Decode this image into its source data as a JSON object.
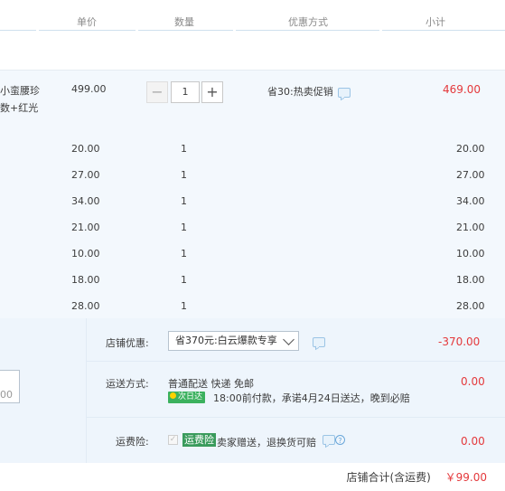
{
  "header": {
    "unit_price": "单价",
    "quantity": "数量",
    "discount_method": "优惠方式",
    "subtotal": "小计"
  },
  "main_item": {
    "name_line1": "小蛮腰珍",
    "name_line2": "数+红光",
    "price": "499.00",
    "quantity": "1",
    "minus": "−",
    "plus": "+",
    "promo": "省30:热卖促销",
    "subtotal": "469.00"
  },
  "items": [
    {
      "price": "20.00",
      "qty": "1",
      "subtotal": "20.00"
    },
    {
      "price": "27.00",
      "qty": "1",
      "subtotal": "27.00"
    },
    {
      "price": "34.00",
      "qty": "1",
      "subtotal": "34.00"
    },
    {
      "price": "21.00",
      "qty": "1",
      "subtotal": "21.00"
    },
    {
      "price": "10.00",
      "qty": "1",
      "subtotal": "10.00"
    },
    {
      "price": "18.00",
      "qty": "1",
      "subtotal": "18.00"
    },
    {
      "price": "28.00",
      "qty": "1",
      "subtotal": "28.00"
    }
  ],
  "shop_discount": {
    "label": "店铺优惠:",
    "selected": "省370元:白云爆款专享",
    "amount": "-370.00"
  },
  "shipping": {
    "label": "运送方式:",
    "method": "普通配送 快递 免邮",
    "badge": "次日达",
    "promise": "18:00前付款，承诺4月24日送达，晚到必赔",
    "amount": "0.00"
  },
  "freight_insurance": {
    "label": "运费险:",
    "check": "✓",
    "badge": "运费险",
    "desc": "卖家赠送，退换货可赔",
    "help": "?",
    "amount": "0.00"
  },
  "note": {
    "partial_value": "00"
  },
  "total": {
    "label": "店铺合计(含运费)",
    "amount": "￥99.00"
  },
  "colors": {
    "accent_red": "#e4393c",
    "row_bg": "#f3f8fd",
    "green_badge": "#3a9b5c"
  }
}
